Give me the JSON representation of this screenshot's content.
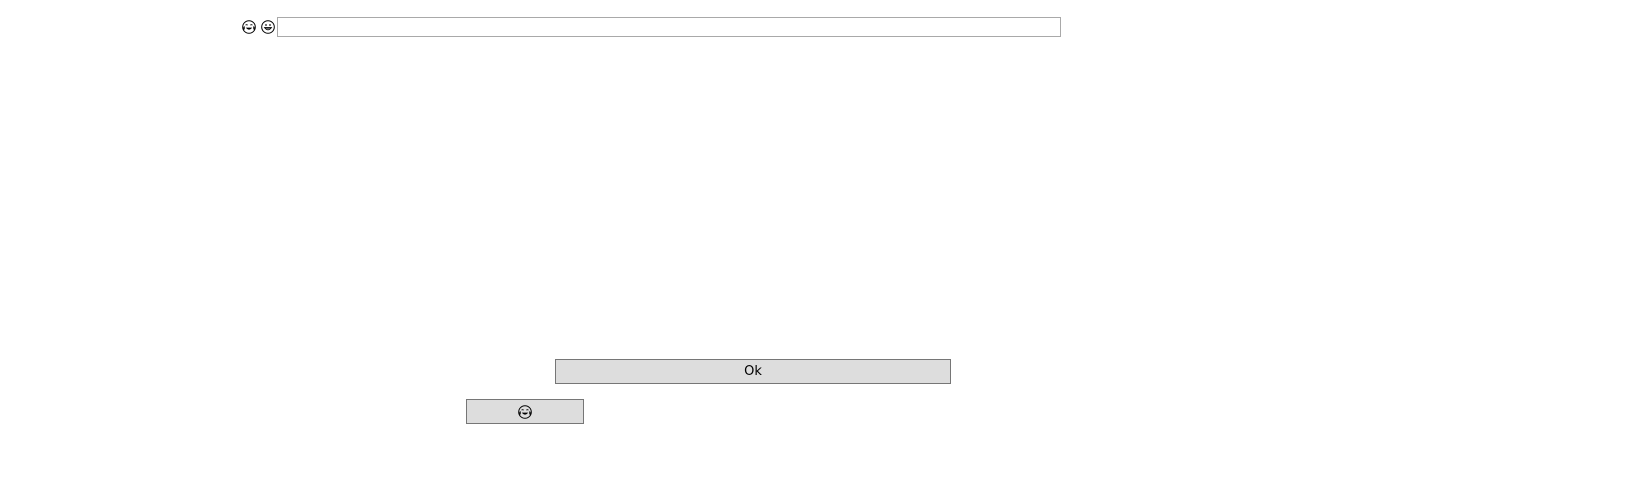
{
  "toolbar": {
    "icons": [
      {
        "name": "laughing-face-with-tears-icon",
        "glyph": "😂"
      },
      {
        "name": "grinning-face-icon",
        "glyph": "😀"
      }
    ],
    "input_value": "",
    "input_placeholder": ""
  },
  "buttons": {
    "ok_label": "Ok",
    "emoji_button_icon": "laughing-face-with-tears-icon"
  },
  "colors": {
    "button_bg": "#dddddd",
    "button_border": "#767676",
    "input_border": "#a9a9a9",
    "page_bg": "#ffffff"
  }
}
